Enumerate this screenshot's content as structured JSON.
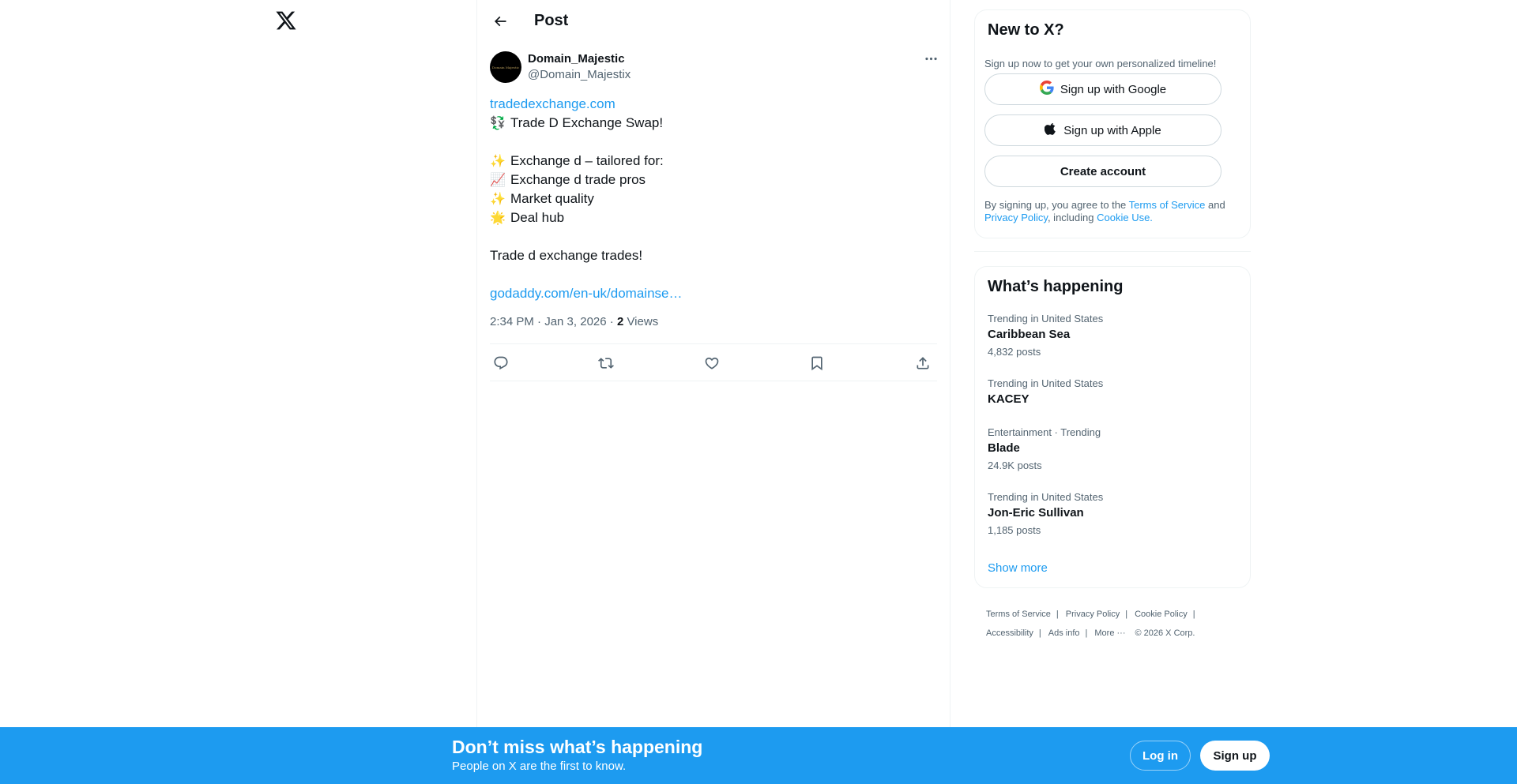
{
  "page": {
    "title": "Post"
  },
  "post": {
    "author": {
      "display_name": "Domain_Majestic",
      "handle": "@Domain_Majestix",
      "avatar_text": "Domain Majestic"
    },
    "link_top": "tradedexchange.com",
    "lines": {
      "headline": {
        "emoji": "💱",
        "text": "Trade D Exchange Swap!"
      },
      "l1": {
        "emoji": "✨",
        "text": "Exchange d – tailored for:"
      },
      "l2": {
        "emoji": "📈",
        "text": "Exchange d trade pros"
      },
      "l3": {
        "emoji": "✨",
        "text": "Market quality"
      },
      "l4": {
        "emoji": "🌟",
        "text": "Deal hub"
      },
      "closing": "Trade d exchange trades!"
    },
    "link_bottom": "godaddy.com/en-uk/domainse…",
    "timestamp": "2:34 PM · Jan 3, 2026",
    "separator": " · ",
    "views_count": "2",
    "views_label": "Views"
  },
  "actions": {
    "reply": "reply-icon",
    "repost": "repost-icon",
    "like": "heart-icon",
    "bookmark": "bookmark-icon",
    "share": "share-icon"
  },
  "signup": {
    "title": "New to X?",
    "subtitle": "Sign up now to get your own personalized timeline!",
    "google": "Sign up with Google",
    "apple": "Sign up with Apple",
    "create": "Create account",
    "terms_prefix": "By signing up, you agree to the ",
    "terms_link": "Terms of Service",
    "terms_and": " and",
    "privacy_link": "Privacy Policy",
    "terms_including": ", including ",
    "cookie_link": "Cookie Use."
  },
  "trends": {
    "title": "What’s happening",
    "items": [
      {
        "context": "Trending in United States",
        "name": "Caribbean Sea",
        "count": "4,832 posts"
      },
      {
        "context": "Trending in United States",
        "name": "KACEY",
        "count": ""
      },
      {
        "context": "Entertainment · Trending",
        "name": "Blade",
        "count": "24.9K posts"
      },
      {
        "context": "Trending in United States",
        "name": "Jon-Eric Sullivan",
        "count": "1,185 posts"
      }
    ],
    "show_more": "Show more"
  },
  "footer": {
    "terms": "Terms of Service",
    "privacy": "Privacy Policy",
    "cookie": "Cookie Policy",
    "accessibility": "Accessibility",
    "ads": "Ads info",
    "more": "More ···",
    "copyright": "© 2026 X Corp."
  },
  "banner": {
    "title": "Don’t miss what’s happening",
    "subtitle": "People on X are the first to know.",
    "login": "Log in",
    "signup": "Sign up"
  },
  "colors": {
    "accent": "#1d9bf0",
    "text": "#0f1419",
    "secondary": "#536471",
    "border": "#eff3f4"
  }
}
